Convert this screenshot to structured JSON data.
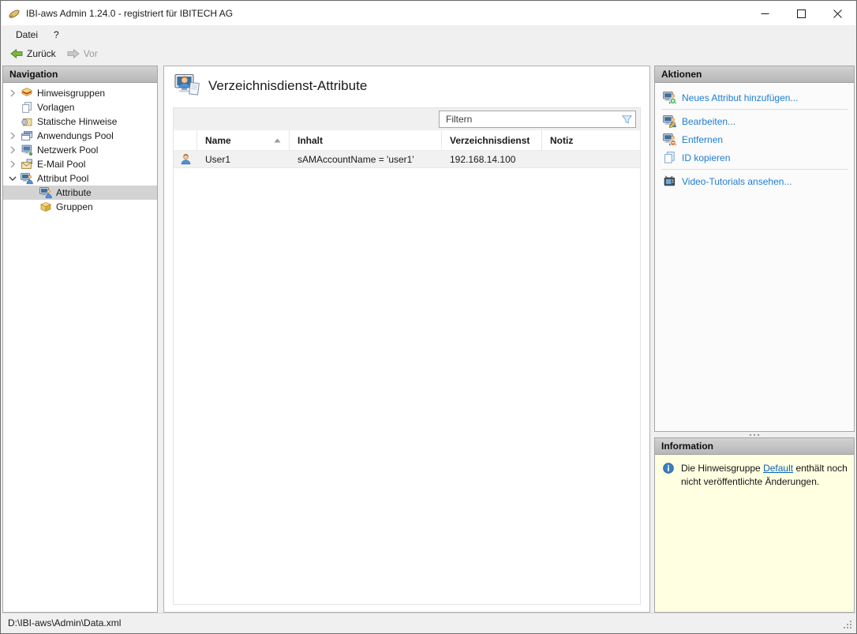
{
  "window": {
    "title": "IBI-aws Admin 1.24.0 - registriert für IBITECH AG"
  },
  "menu": {
    "datei": "Datei",
    "help": "?"
  },
  "toolbar": {
    "back": "Zurück",
    "forward": "Vor"
  },
  "navigation": {
    "header": "Navigation",
    "items": [
      {
        "label": "Hinweisgruppen",
        "icon": "notice-groups-icon",
        "expander": "collapsed",
        "indent": 0,
        "selected": false
      },
      {
        "label": "Vorlagen",
        "icon": "templates-icon",
        "expander": "none",
        "indent": 0,
        "selected": false
      },
      {
        "label": "Statische Hinweise",
        "icon": "static-notices-icon",
        "expander": "none",
        "indent": 0,
        "selected": false
      },
      {
        "label": "Anwendungs Pool",
        "icon": "application-pool-icon",
        "expander": "collapsed",
        "indent": 0,
        "selected": false
      },
      {
        "label": "Netzwerk Pool",
        "icon": "network-pool-icon",
        "expander": "collapsed",
        "indent": 0,
        "selected": false
      },
      {
        "label": "E-Mail Pool",
        "icon": "email-pool-icon",
        "expander": "collapsed",
        "indent": 0,
        "selected": false
      },
      {
        "label": "Attribut Pool",
        "icon": "attribute-pool-icon",
        "expander": "expanded",
        "indent": 0,
        "selected": false
      },
      {
        "label": "Attribute",
        "icon": "attribute-icon",
        "expander": "none",
        "indent": 1,
        "selected": true
      },
      {
        "label": "Gruppen",
        "icon": "groups-icon",
        "expander": "none",
        "indent": 1,
        "selected": false
      }
    ]
  },
  "main": {
    "title": "Verzeichnisdienst-Attribute",
    "title_icon": "directory-attributes-icon",
    "filter": {
      "placeholder": "Filtern",
      "icon": "filter-icon"
    },
    "table": {
      "columns": [
        {
          "label": "Name",
          "sorted": "asc"
        },
        {
          "label": "Inhalt"
        },
        {
          "label": "Verzeichnisdienst"
        },
        {
          "label": "Notiz"
        }
      ],
      "rows": [
        {
          "icon": "user-icon",
          "name": "User1",
          "inhalt": "sAMAccountName = 'user1'",
          "verzeichnisdienst": "192.168.14.100",
          "notiz": ""
        }
      ]
    }
  },
  "actions": {
    "header": "Aktionen",
    "items": [
      {
        "label": "Neues Attribut hinzufügen...",
        "icon": "attribute-add-icon"
      },
      {
        "label": "Bearbeiten...",
        "icon": "attribute-edit-icon"
      },
      {
        "label": "Entfernen",
        "icon": "attribute-remove-icon"
      },
      {
        "label": "ID kopieren",
        "icon": "copy-icon"
      },
      {
        "label": "Video-Tutorials ansehen...",
        "icon": "video-tutorials-icon"
      }
    ]
  },
  "information": {
    "header": "Information",
    "icon": "info-icon",
    "text_before": "Die Hinweisgruppe",
    "link_label": "Default",
    "text_after": "enthält noch nicht veröffentlichte Änderungen."
  },
  "statusbar": {
    "path": "D:\\IBI-aws\\Admin\\Data.xml"
  },
  "colors": {
    "action_link": "#1d7dd2",
    "info_link": "#0563c1",
    "info_background": "#ffffe1",
    "selection_background": "#d3d3d3",
    "panel_header_background": "#bfbfbf"
  }
}
